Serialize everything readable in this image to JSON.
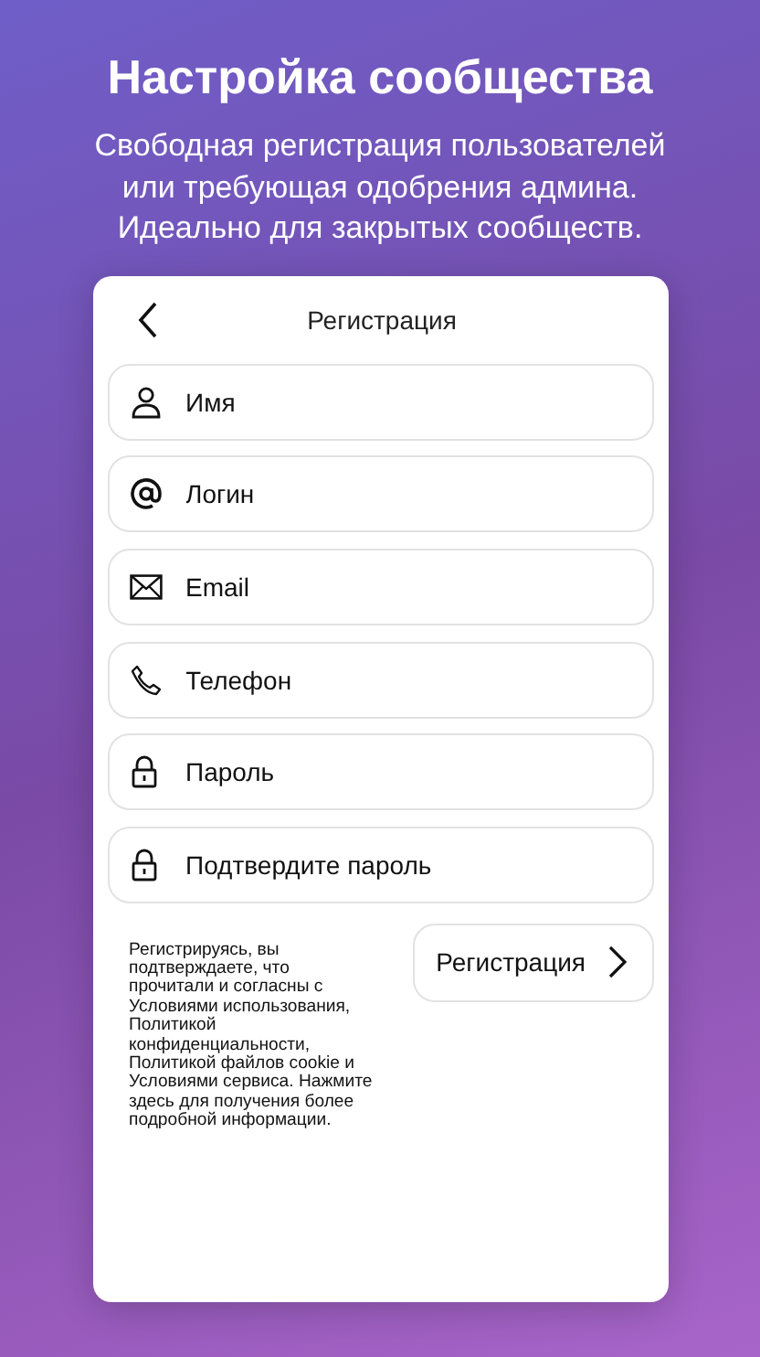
{
  "title": "Настройка сообщества",
  "subtitle": "Свободная регистрация пользователей или требующая одобрения админа. Идеально для закрытых сообществ.",
  "screen": {
    "title": "Регистрация",
    "fields": [
      {
        "kind": "person",
        "placeholder": "Имя"
      },
      {
        "kind": "at",
        "placeholder": "Логин"
      },
      {
        "kind": "mail",
        "placeholder": "Email"
      },
      {
        "kind": "phone",
        "placeholder": "Телефон"
      },
      {
        "kind": "lock",
        "placeholder": "Пароль"
      },
      {
        "kind": "lock",
        "placeholder": "Подтвердите пароль"
      }
    ],
    "terms": "Регистрируясь, вы подтверждаете, что прочитали и согласны с Условиями использования, Политикой конфиденциальности, Политикой файлов cookie и Условиями сервиса. Нажмите здесь для получения более подробной информации.",
    "submit": "Регистрация"
  }
}
